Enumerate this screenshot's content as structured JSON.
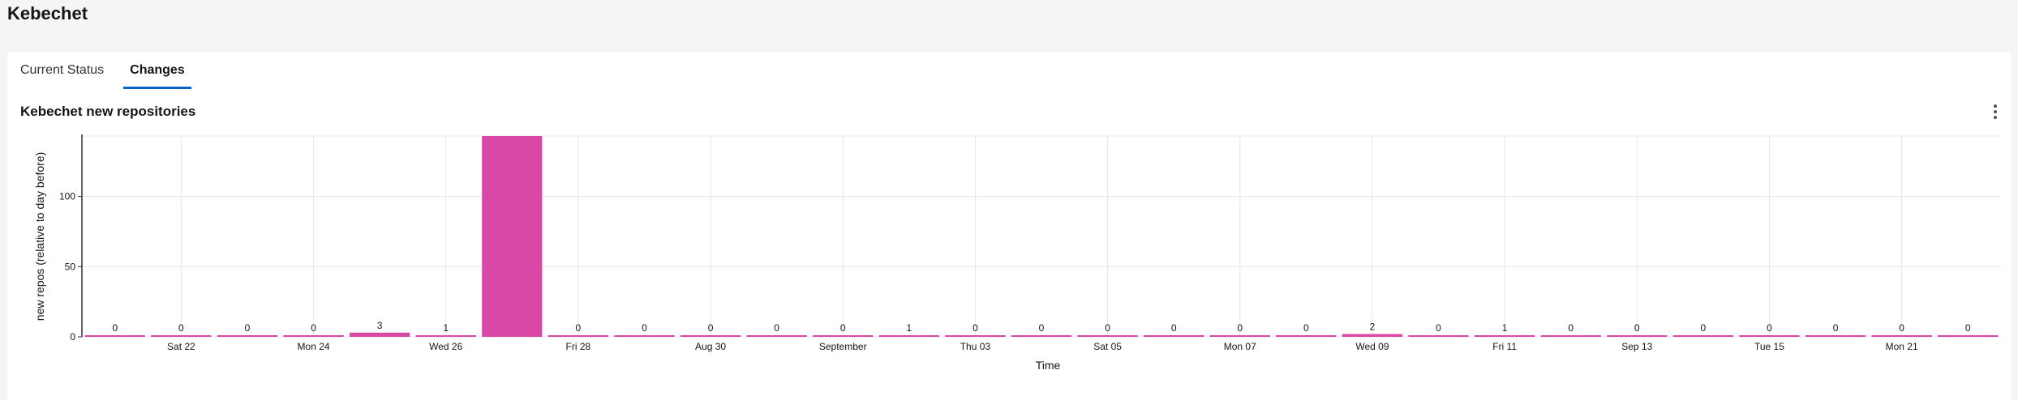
{
  "page": {
    "title": "Kebechet"
  },
  "tabs": [
    {
      "label": "Current Status",
      "active": false
    },
    {
      "label": "Changes",
      "active": true
    }
  ],
  "panel": {
    "title": "Kebechet new repositories",
    "menu_icon": "kebab-vertical-icon"
  },
  "colors": {
    "bar": "#d63e9f",
    "tab_underline": "#0066cc"
  },
  "chart_data": {
    "type": "bar",
    "title": "",
    "xlabel": "Time",
    "ylabel": "new repos (relative to day before)",
    "ylim": [
      0,
      143
    ],
    "yticks": [
      0,
      50,
      100
    ],
    "grid": true,
    "values": [
      0,
      0,
      0,
      0,
      3,
      1,
      143,
      0,
      0,
      0,
      0,
      0,
      1,
      0,
      0,
      0,
      0,
      0,
      0,
      2,
      0,
      1,
      0,
      0,
      0,
      0,
      0,
      0,
      0
    ],
    "x_tick_labels": [
      {
        "index": 1,
        "label": "Sat 22"
      },
      {
        "index": 3,
        "label": "Mon 24"
      },
      {
        "index": 5,
        "label": "Wed 26"
      },
      {
        "index": 7,
        "label": "Fri 28"
      },
      {
        "index": 9,
        "label": "Aug 30"
      },
      {
        "index": 11,
        "label": "September"
      },
      {
        "index": 13,
        "label": "Thu 03"
      },
      {
        "index": 15,
        "label": "Sat 05"
      },
      {
        "index": 17,
        "label": "Mon 07"
      },
      {
        "index": 19,
        "label": "Wed 09"
      },
      {
        "index": 21,
        "label": "Fri 11"
      },
      {
        "index": 23,
        "label": "Sep 13"
      },
      {
        "index": 25,
        "label": "Tue 15"
      },
      {
        "index": 27,
        "label": "Mon 21"
      }
    ]
  }
}
